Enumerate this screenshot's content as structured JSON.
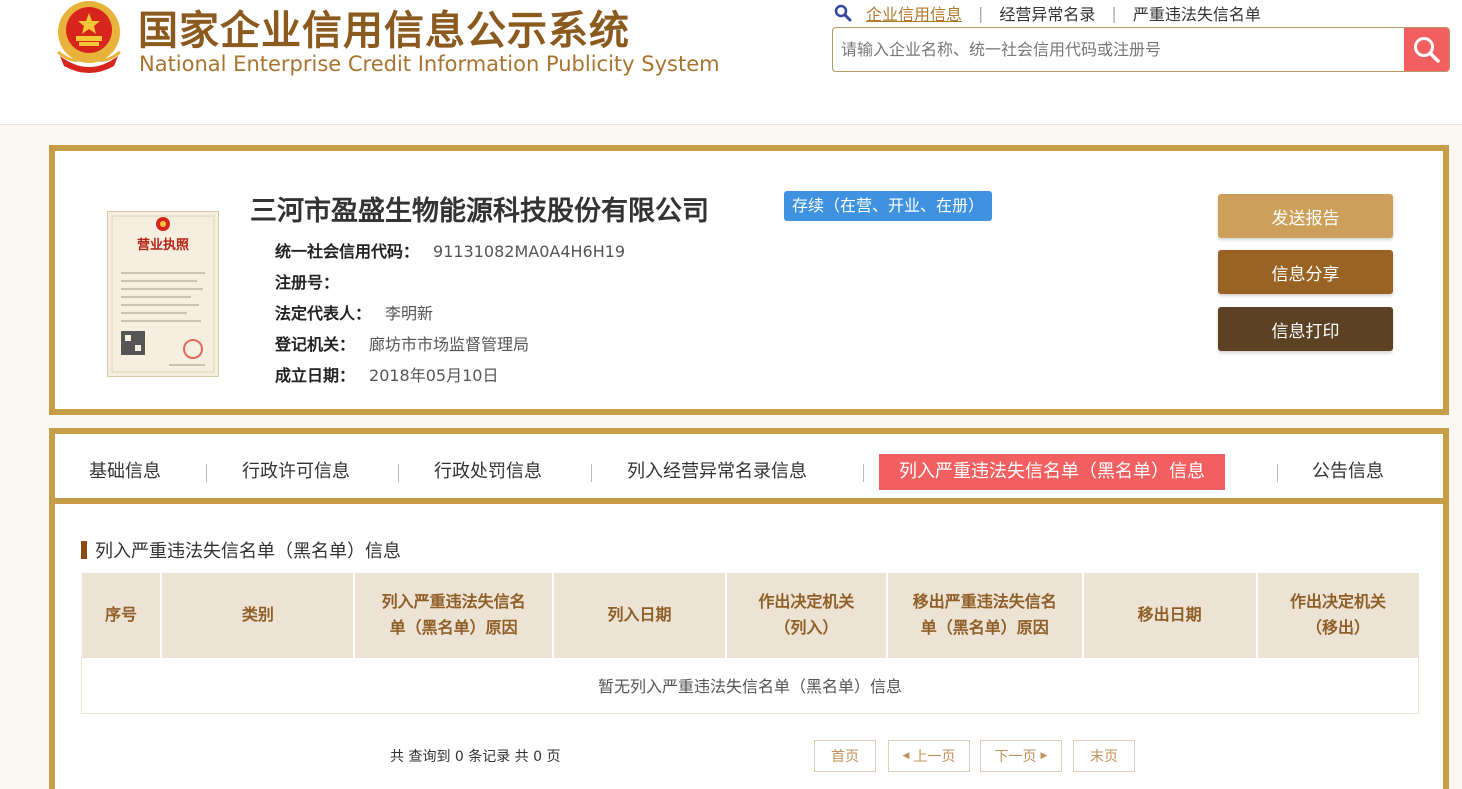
{
  "header": {
    "title_cn": "国家企业信用信息公示系统",
    "title_en": "National Enterprise Credit Information Publicity System",
    "links": [
      "企业信用信息",
      "经营异常名录",
      "严重违法失信名单"
    ],
    "search_placeholder": "请输入企业名称、统一社会信用代码或注册号"
  },
  "company": {
    "name": "三河市盈盛生物能源科技股份有限公司",
    "status": "存续（在营、开业、在册）",
    "fields": [
      {
        "label": "统一社会信用代码：",
        "value": "91131082MA0A4H6H19"
      },
      {
        "label": "注册号：",
        "value": ""
      },
      {
        "label": "法定代表人：",
        "value": "李明新"
      },
      {
        "label": "登记机关：",
        "value": "廊坊市市场监督管理局"
      },
      {
        "label": "成立日期：",
        "value": "2018年05月10日"
      }
    ],
    "license_title": "营业执照",
    "actions": [
      "发送报告",
      "信息分享",
      "信息打印"
    ]
  },
  "tabs": [
    "基础信息",
    "行政许可信息",
    "行政处罚信息",
    "列入经营异常名录信息",
    "列入严重违法失信名单（黑名单）信息",
    "公告信息"
  ],
  "active_tab": 4,
  "section": {
    "title": "列入严重违法失信名单（黑名单）信息",
    "columns": [
      [
        "序号"
      ],
      [
        "类别"
      ],
      [
        "列入严重违法失信名",
        "单（黑名单）原因"
      ],
      [
        "列入日期"
      ],
      [
        "作出决定机关",
        "（列入）"
      ],
      [
        "移出严重违法失信名",
        "单（黑名单）原因"
      ],
      [
        "移出日期"
      ],
      [
        "作出决定机关",
        "（移出）"
      ]
    ],
    "empty_text": "暂无列入严重违法失信名单（黑名单）信息"
  },
  "pager": {
    "summary": "共 查询到 0 条记录 共 0 页",
    "first": "首页",
    "prev": "上一页",
    "next": "下一页",
    "last": "末页"
  },
  "colors": {
    "gold_border": "#c79e48",
    "accent_red": "#f15f60",
    "status_blue": "#3e92df",
    "btn_send": "#cca05a",
    "btn_share": "#996324",
    "btn_print": "#5c4222"
  }
}
